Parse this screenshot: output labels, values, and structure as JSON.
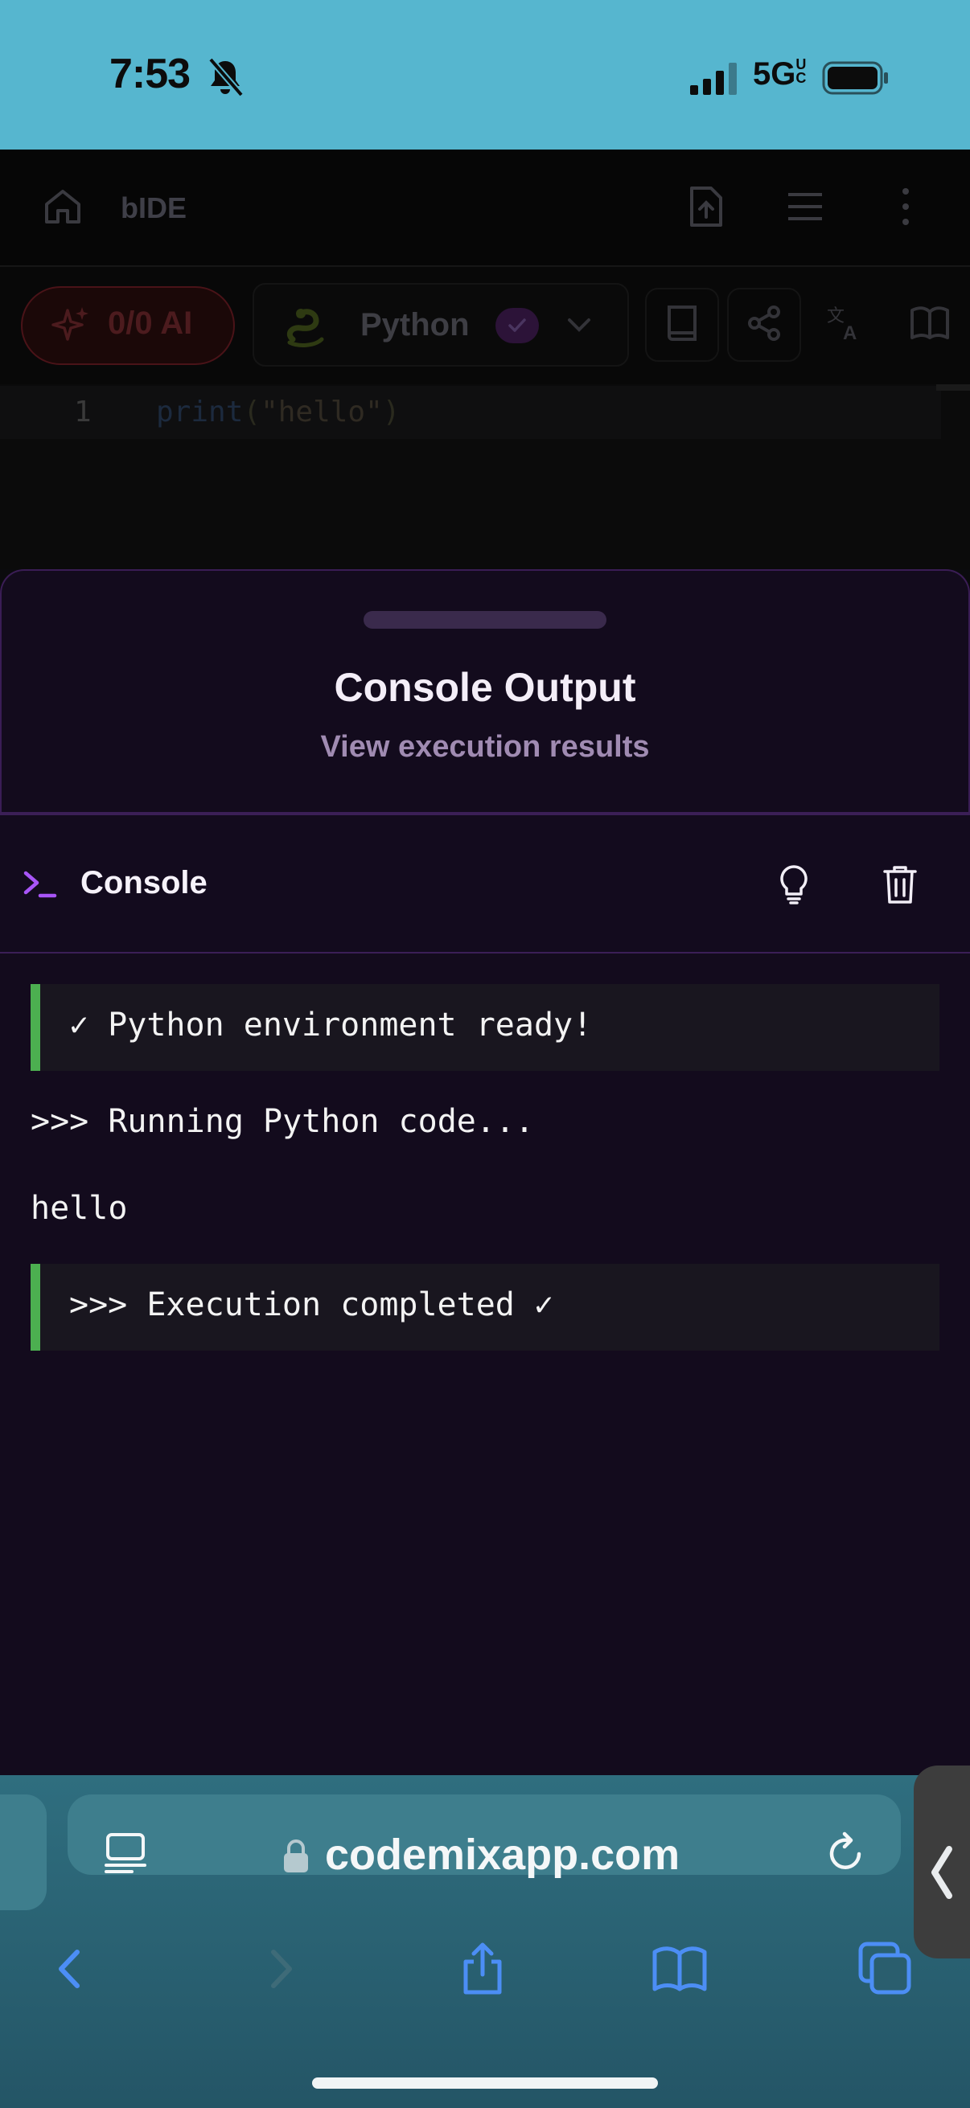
{
  "status_bar": {
    "time": "7:53",
    "network": "5GUC",
    "network_main": "5G",
    "network_sup": "UC"
  },
  "app": {
    "title": "bIDE",
    "ai_button_label": "0/0 AI",
    "language_label": "Python",
    "editor": {
      "line_number": "1",
      "code_func": "print",
      "code_open": "(",
      "code_string": "\"hello\"",
      "code_close": ")"
    }
  },
  "sheet": {
    "title": "Console Output",
    "subtitle": "View execution results",
    "console_label": "Console",
    "output": [
      {
        "kind": "success",
        "text": "✓ Python environment ready!"
      },
      {
        "kind": "plain",
        "text": ">>> Running Python code..."
      },
      {
        "kind": "plain",
        "text": "hello"
      },
      {
        "kind": "success",
        "text": ">>> Execution completed ✓"
      }
    ]
  },
  "browser": {
    "url": "codemixapp.com"
  },
  "colors": {
    "accent_purple": "#a855f7",
    "success_green": "#4caf50",
    "status_bar_bg": "#56b6cf",
    "browser_bar_bg": "#2f6e7f",
    "browser_icon_blue": "#4c8ef5"
  },
  "icons": {
    "status": [
      "bell-slash-icon",
      "signal-icon",
      "battery-icon"
    ],
    "app_header": [
      "home-icon",
      "file-upload-icon",
      "menu-icon",
      "kebab-menu-icon"
    ],
    "toolbar": [
      "sparkle-icon",
      "python-snake-icon",
      "check-icon",
      "chevron-down-icon",
      "book-icon",
      "share-icon",
      "translate-icon",
      "open-book-icon"
    ],
    "console": [
      "terminal-prompt-icon",
      "lightbulb-icon",
      "trash-icon"
    ],
    "browser": [
      "reader-icon",
      "lock-icon",
      "reload-icon",
      "back-icon",
      "forward-icon",
      "share-icon",
      "bookmarks-icon",
      "tabs-icon"
    ]
  }
}
